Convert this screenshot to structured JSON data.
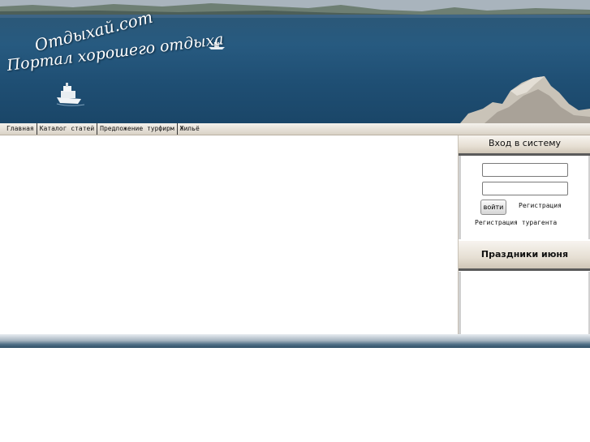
{
  "header": {
    "logo_line1": "Отдыхай.com",
    "logo_line2": "Портал хорошего отдыха"
  },
  "nav": {
    "items": [
      {
        "label": "Главная"
      },
      {
        "label": "Каталог статей"
      },
      {
        "label": "Предложение турфирм"
      },
      {
        "label": "Жильё"
      }
    ]
  },
  "sidebar": {
    "login": {
      "title": "Вход в систему",
      "username_value": "",
      "password_value": "",
      "submit_label": "войти",
      "register_link": "Регистрация",
      "agent_register_link": "Регистрация турагента"
    },
    "holidays": {
      "title": "Праздники июня"
    }
  },
  "colors": {
    "sea": "#275a80",
    "footer_dark": "#2f4f66",
    "panel_separator": "#5a5a5a"
  }
}
